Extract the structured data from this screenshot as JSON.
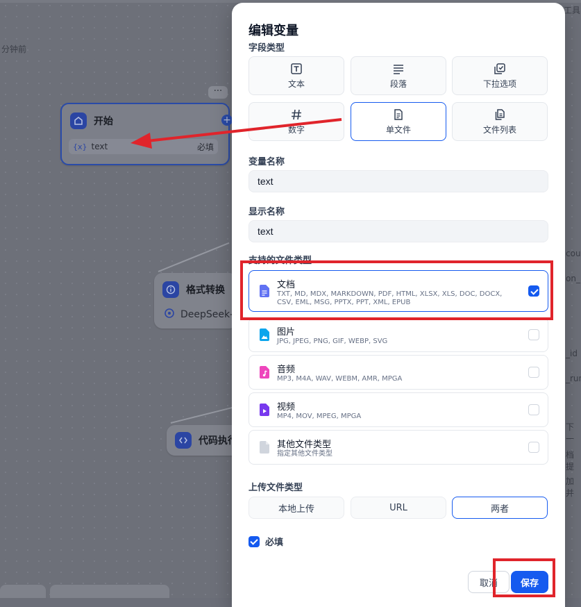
{
  "background": {
    "time_hint": "分钟前",
    "top_right_text": "工具",
    "start_node": {
      "title": "开始",
      "var_tag": "{x}",
      "var_name": "text",
      "required": "必填"
    },
    "format_node": {
      "title": "格式转换",
      "model": "DeepSeek-"
    },
    "code_node": {
      "title": "代码执行"
    },
    "more_dots": "···",
    "right_peeks": [
      "cou",
      "on_",
      "_id",
      "_run",
      "下一",
      "档提",
      "加并"
    ]
  },
  "modal": {
    "title": "编辑变量",
    "field_type_label": "字段类型",
    "field_types": [
      {
        "label": "文本",
        "icon": "text-type-icon"
      },
      {
        "label": "段落",
        "icon": "paragraph-icon"
      },
      {
        "label": "下拉选项",
        "icon": "select-icon"
      },
      {
        "label": "数字",
        "icon": "hash-icon"
      },
      {
        "label": "单文件",
        "icon": "single-file-icon"
      },
      {
        "label": "文件列表",
        "icon": "file-list-icon"
      }
    ],
    "selected_field_type": "单文件",
    "var_name_label": "变量名称",
    "var_name_value": "text",
    "display_name_label": "显示名称",
    "display_name_value": "text",
    "supported_types_label": "支持的文件类型",
    "file_types": [
      {
        "title": "文档",
        "desc": "TXT, MD, MDX, MARKDOWN, PDF, HTML, XLSX, XLS, DOC, DOCX, CSV, EML, MSG, PPTX, PPT, XML, EPUB",
        "checked": true,
        "color": "#6172f3"
      },
      {
        "title": "图片",
        "desc": "JPG, JPEG, PNG, GIF, WEBP, SVG",
        "checked": false,
        "color": "#0ba5ec"
      },
      {
        "title": "音频",
        "desc": "MP3, M4A, WAV, WEBM, AMR, MPGA",
        "checked": false,
        "color": "#ee46bc"
      },
      {
        "title": "视频",
        "desc": "MP4, MOV, MPEG, MPGA",
        "checked": false,
        "color": "#7839ee"
      },
      {
        "title": "其他文件类型",
        "desc": "指定其他文件类型",
        "checked": false,
        "color": "#98a2b3"
      }
    ],
    "upload_type_label": "上传文件类型",
    "upload_options": [
      "本地上传",
      "URL",
      "两者"
    ],
    "selected_upload": "两者",
    "required_label": "必填",
    "required_checked": true,
    "cancel_label": "取消",
    "save_label": "保存"
  },
  "colors": {
    "primary": "#155aef",
    "annotation_red": "#e0242b"
  }
}
